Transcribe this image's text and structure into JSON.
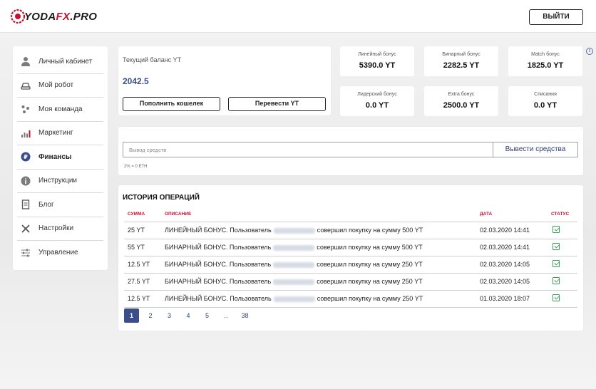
{
  "header": {
    "logo_main": "YODA",
    "logo_fx": "FX",
    "logo_tail": ".PRO",
    "logout_label": "ВЫЙТИ"
  },
  "sidebar": {
    "items": [
      {
        "label": "Личный кабинет",
        "icon": "user-icon",
        "active": false
      },
      {
        "label": "Мой робот",
        "icon": "robot-icon",
        "active": false
      },
      {
        "label": "Моя команда",
        "icon": "team-icon",
        "active": false
      },
      {
        "label": "Маркетинг",
        "icon": "chart-icon",
        "active": false
      },
      {
        "label": "Финансы",
        "icon": "ruble-icon",
        "active": true
      },
      {
        "label": "Инструкции",
        "icon": "info-icon",
        "active": false
      },
      {
        "label": "Блог",
        "icon": "document-icon",
        "active": false
      },
      {
        "label": "Настройки",
        "icon": "tools-icon",
        "active": false
      },
      {
        "label": "Управление",
        "icon": "sliders-icon",
        "active": false
      }
    ]
  },
  "balance": {
    "label": "Текущий баланс YT",
    "value": "2042.5",
    "topup_label": "Пополнить кошелек",
    "transfer_label": "Перевести YT"
  },
  "stats": [
    {
      "label": "Линейный бонус",
      "value": "5390.0 YT"
    },
    {
      "label": "Бинарный бонус",
      "value": "2282.5 YT"
    },
    {
      "label": "Match бонус",
      "value": "1825.0 YT"
    },
    {
      "label": "Лидерский бонус",
      "value": "0.0 YT"
    },
    {
      "label": "Extra бонус",
      "value": "2500.0 YT"
    },
    {
      "label": "Списания",
      "value": "0.0 YT"
    }
  ],
  "withdraw": {
    "placeholder": "Вывод средств",
    "button_label": "Вывести средства",
    "note": "2% = 0 ETH"
  },
  "history": {
    "title": "ИСТОРИЯ ОПЕРАЦИЙ",
    "columns": {
      "amount": "СУММА",
      "description": "ОПИСАНИЕ",
      "date": "ДАТА",
      "status": "СТАТУС"
    },
    "rows": [
      {
        "amount": "25 YT",
        "desc_pre": "ЛИНЕЙНЫЙ БОНУС. Пользователь",
        "desc_post": "совершил покупку на сумму 500 YT",
        "date": "02.03.2020 14:41"
      },
      {
        "amount": "55 YT",
        "desc_pre": "БИНАРНЫЙ БОНУС. Пользователь",
        "desc_post": "совершил покупку на сумму 500 YT",
        "date": "02.03.2020 14:41"
      },
      {
        "amount": "12.5 YT",
        "desc_pre": "БИНАРНЫЙ БОНУС. Пользователь",
        "desc_post": "совершил покупку на сумму 250 YT",
        "date": "02.03.2020 14:05"
      },
      {
        "amount": "27.5 YT",
        "desc_pre": "БИНАРНЫЙ БОНУС. Пользователь",
        "desc_post": "совершил покупку на сумму 250 YT",
        "date": "02.03.2020 14:05"
      },
      {
        "amount": "12.5 YT",
        "desc_pre": "ЛИНЕЙНЫЙ БОНУС. Пользователь",
        "desc_post": "совершил покупку на сумму 250 YT",
        "date": "01.03.2020 18:07"
      }
    ],
    "pages": [
      "1",
      "2",
      "3",
      "4",
      "5",
      "...",
      "38"
    ],
    "current_page": "1"
  },
  "colors": {
    "accent": "#3c4e8a",
    "brand_red": "#c8102e",
    "status_green": "#35a35a"
  }
}
